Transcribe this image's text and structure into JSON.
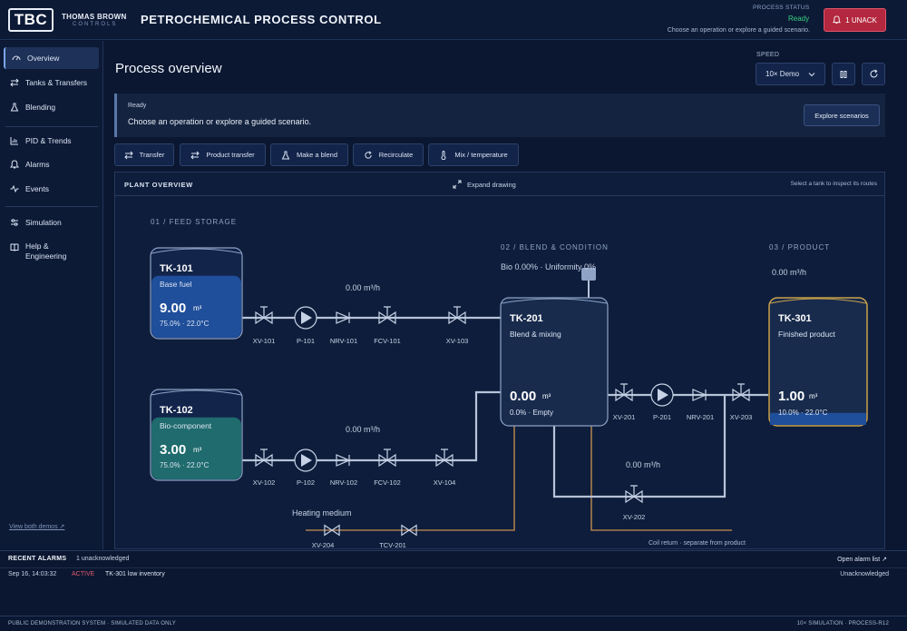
{
  "header": {
    "logo_mark": "TBC",
    "logo_name": "THOMAS BROWN",
    "logo_sub": "CONTROLS",
    "title": "PETROCHEMICAL PROCESS CONTROL",
    "status_label": "PROCESS STATUS",
    "status_value": "Ready",
    "status_message": "Choose an operation or explore a guided scenario.",
    "unack_label": "1 UNACK"
  },
  "sidebar": {
    "items": [
      {
        "label": "Overview",
        "icon": "gauge-icon"
      },
      {
        "label": "Tanks & Transfers",
        "icon": "transfer-icon"
      },
      {
        "label": "Blending",
        "icon": "flask-icon"
      },
      {
        "label": "PID & Trends",
        "icon": "chart-icon"
      },
      {
        "label": "Alarms",
        "icon": "bell-icon"
      },
      {
        "label": "Events",
        "icon": "activity-icon"
      },
      {
        "label": "Simulation",
        "icon": "sliders-icon"
      },
      {
        "label": "Help & Engineering",
        "icon": "book-icon"
      }
    ],
    "footer_link": "View both demos ↗"
  },
  "main": {
    "title": "Process overview",
    "speed_label": "SPEED",
    "speed_value": "10× Demo",
    "banner_title": "Ready",
    "banner_message": "Choose an operation or explore a guided scenario.",
    "explore_label": "Explore scenarios",
    "operations": [
      "Transfer",
      "Product transfer",
      "Make a blend",
      "Recirculate",
      "Mix / temperature"
    ]
  },
  "plant": {
    "title": "PLANT OVERVIEW",
    "expand_label": "Expand drawing",
    "hint": "Select a tank to inspect its routes",
    "sections": {
      "feed": "01 / FEED STORAGE",
      "blend": "02 / BLEND & CONDITION",
      "product": "03 / PRODUCT"
    },
    "blend_status": "Bio 0.00% · Uniformity 0%",
    "flows": {
      "line1": "0.00 m³/h",
      "line2": "0.00 m³/h",
      "product": "0.00 m³/h",
      "recirc": "0.00 m³/h"
    },
    "heating_label": "Heating medium",
    "coil_note": "Coil return · separate from product",
    "tanks": [
      {
        "id": "TK-101",
        "name": "Base fuel",
        "volume": "9.00",
        "unit": "m³",
        "detail": "75.0% · 22.0°C",
        "level": 0.75,
        "color": "#1f4e9a"
      },
      {
        "id": "TK-102",
        "name": "Bio-component",
        "volume": "3.00",
        "unit": "m³",
        "detail": "75.0% · 22.0°C",
        "level": 0.75,
        "color": "#1f6b6d"
      },
      {
        "id": "TK-201",
        "name": "Blend & mixing",
        "volume": "0.00",
        "unit": "m³",
        "detail": "0.0% · Empty",
        "level": 0.0,
        "color": "#1d3a62"
      },
      {
        "id": "TK-301",
        "name": "Finished product",
        "volume": "1.00",
        "unit": "m³",
        "detail": "10.0% · 22.0°C",
        "level": 0.1,
        "color": "#1f4e9a"
      }
    ],
    "equipment": {
      "xv101": "XV-101",
      "p101": "P-101",
      "nrv101": "NRV-101",
      "fcv101": "FCV-101",
      "xv103": "XV-103",
      "xv102": "XV-102",
      "p102": "P-102",
      "nrv102": "NRV-102",
      "fcv102": "FCV-102",
      "xv104": "XV-104",
      "xv201": "XV-201",
      "p201": "P-201",
      "nrv201": "NRV-201",
      "xv203": "XV-203",
      "xv202": "XV-202",
      "xv204": "XV-204",
      "tcv201": "TCV-201"
    }
  },
  "alarms": {
    "title": "RECENT ALARMS",
    "count": "1 unacknowledged",
    "open_link": "Open alarm list ↗",
    "rows": [
      {
        "time": "Sep 16, 14:03:32",
        "state": "ACTIVE",
        "message": "TK-301 low inventory",
        "ack": "Unacknowledged"
      }
    ]
  },
  "footer": {
    "left": "PUBLIC DEMONSTRATION SYSTEM · SIMULATED DATA ONLY",
    "right": "10× SIMULATION · PROCESS-R12"
  }
}
